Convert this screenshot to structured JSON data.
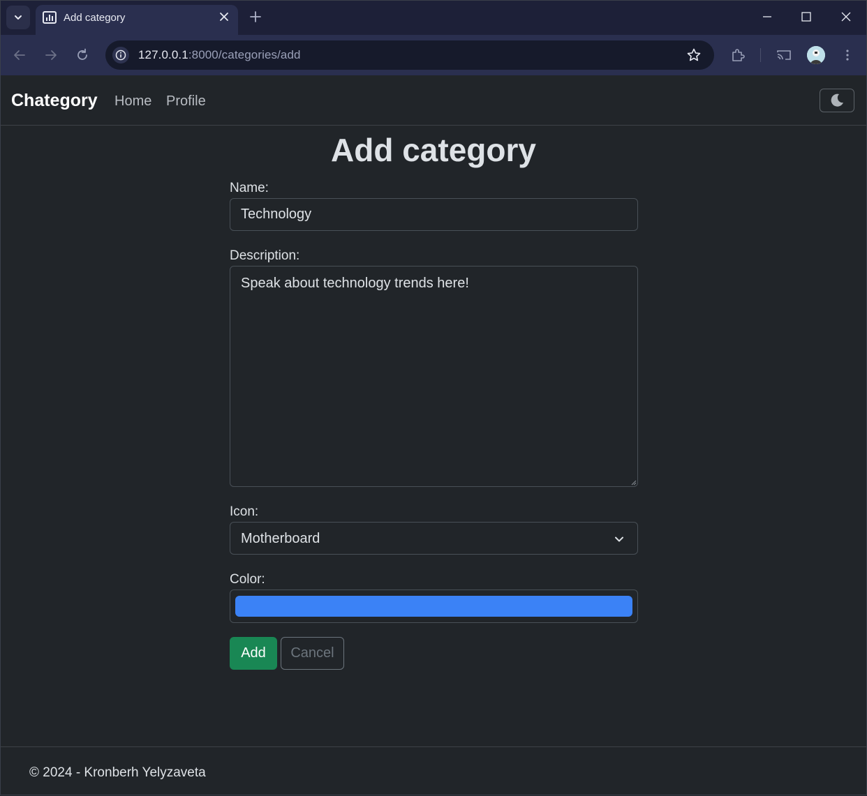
{
  "browser": {
    "tab_title": "Add category",
    "url_host": "127.0.0.1",
    "url_path": ":8000/categories/add"
  },
  "nav": {
    "brand": "Chategory",
    "links": [
      "Home",
      "Profile"
    ]
  },
  "page": {
    "title": "Add category"
  },
  "form": {
    "name_label": "Name:",
    "name_value": "Technology",
    "description_label": "Description:",
    "description_value": "Speak about technology trends here!",
    "icon_label": "Icon:",
    "icon_value": "Motherboard",
    "color_label": "Color:",
    "color_value": "#3b82f6",
    "add_label": "Add",
    "cancel_label": "Cancel"
  },
  "footer": {
    "text": "© 2024 - Kronberh Yelyzaveta"
  },
  "colors": {
    "background": "#212529",
    "success": "#198754",
    "secondary": "#6c757d",
    "browser_frame": "#1d2038"
  }
}
